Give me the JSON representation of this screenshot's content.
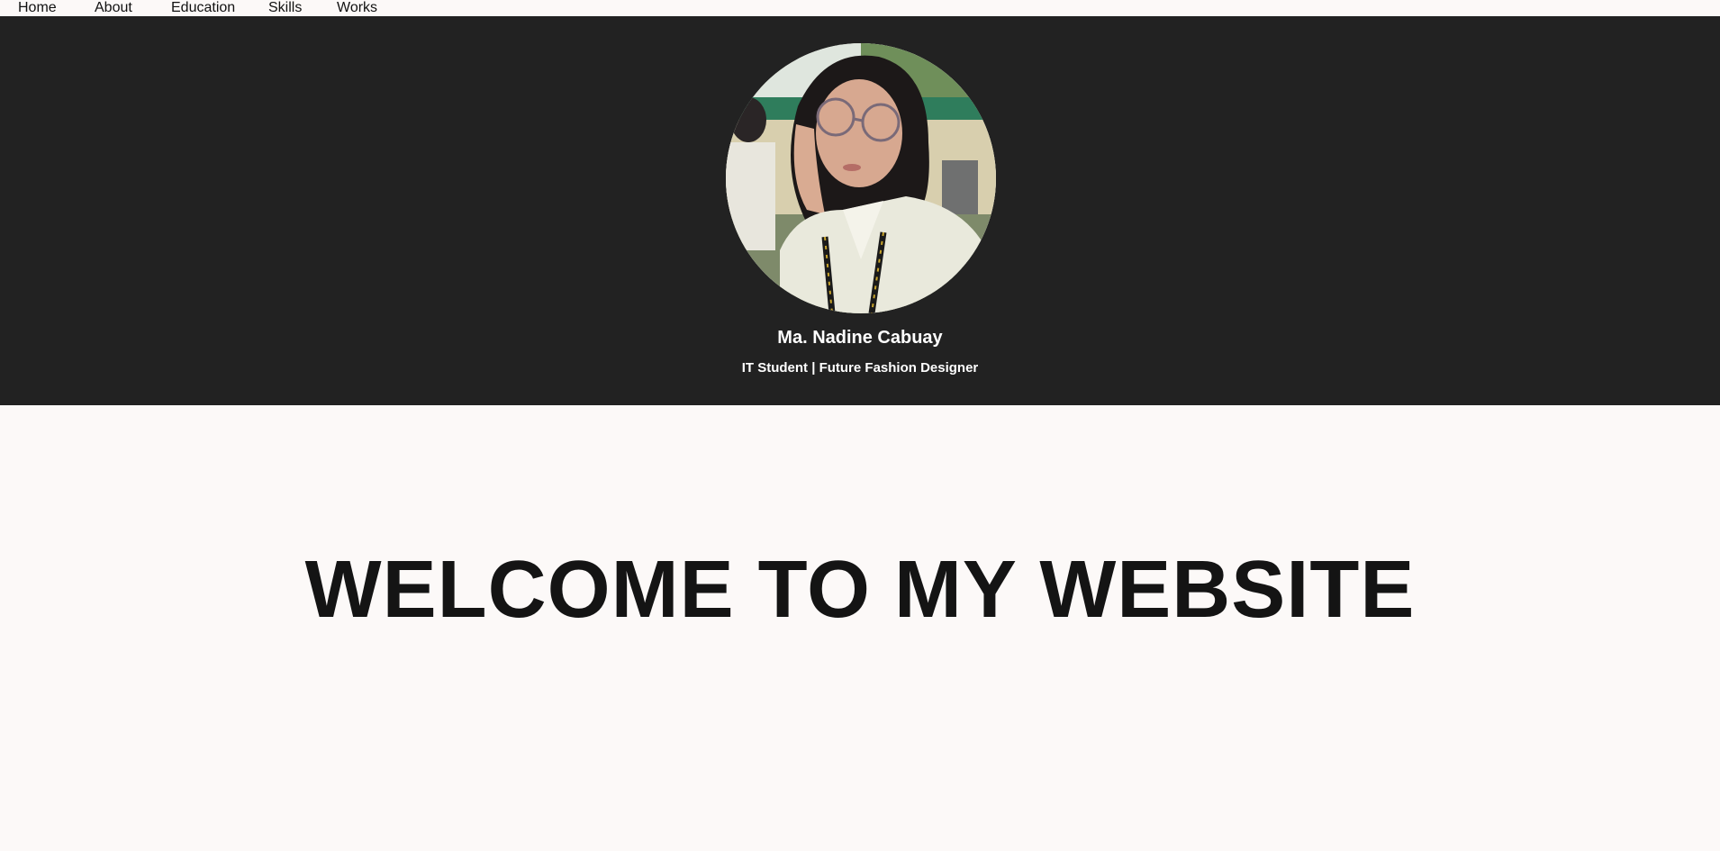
{
  "nav": {
    "items": [
      {
        "label": "Home"
      },
      {
        "label": "About"
      },
      {
        "label": "Education"
      },
      {
        "label": "Skills"
      },
      {
        "label": "Works"
      }
    ]
  },
  "hero": {
    "name": "Ma. Nadine Cabuay",
    "tagline": "IT Student | Future Fashion Designer",
    "avatar_icon": "profile-photo"
  },
  "main": {
    "welcome": "WELCOME TO MY WEBSITE"
  },
  "colors": {
    "background": "#fcf9f8",
    "hero_background": "#222222",
    "hero_text": "#ffffff",
    "heading_text": "#141414"
  }
}
